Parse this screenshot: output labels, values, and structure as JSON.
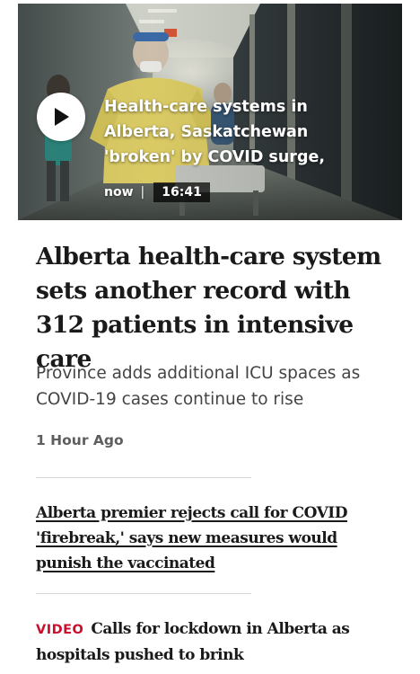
{
  "video": {
    "title": "Health-care systems in Alberta, Saskatchewan 'broken' by COVID surge,",
    "timestamp": "now",
    "separator": "|",
    "duration": "16:41",
    "play_icon": "play-icon"
  },
  "article": {
    "headline": "Alberta health-care system sets another record with 312 patients in intensive care",
    "subheadline": "Province adds additional ICU spaces as COVID-19 cases continue to rise",
    "published": "1 Hour Ago"
  },
  "related_links": [
    {
      "title": "Alberta premier rejects call for COVID 'firebreak,' says new measures would punish the vaccinated"
    }
  ],
  "video_links": [
    {
      "label": "VIDEO",
      "title": "Calls for lockdown in Alberta as hospitals pushed to brink"
    }
  ],
  "colors": {
    "video_label": "#c8102e",
    "headline": "#1a1a1a",
    "subheadline": "#444444",
    "timestamp": "#5e5e5e",
    "divider": "#d6d6d6"
  }
}
